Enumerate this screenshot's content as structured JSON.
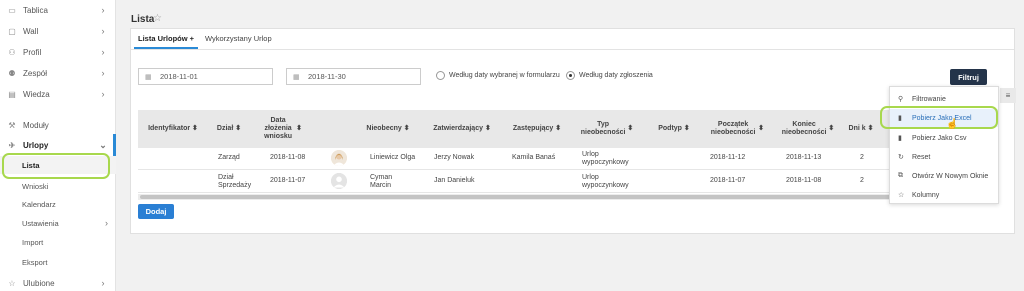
{
  "sidebar": {
    "items": [
      {
        "label": "Tablica",
        "icon": "monitor-icon"
      },
      {
        "label": "Wall",
        "icon": "wall-icon"
      },
      {
        "label": "Profil",
        "icon": "user-icon"
      },
      {
        "label": "Zespół",
        "icon": "users-icon"
      },
      {
        "label": "Wiedza",
        "icon": "book-icon"
      },
      {
        "label": "Moduły",
        "icon": "wrench-icon"
      },
      {
        "label": "Urlopy",
        "icon": "plane-icon"
      }
    ],
    "urlopy_sub": [
      "Lista",
      "Wnioski",
      "Kalendarz",
      "Ustawienia",
      "Import",
      "Eksport"
    ],
    "ulubione": "Ulubione"
  },
  "page": {
    "title": "Lista"
  },
  "tabs": [
    {
      "label": "Lista Urlopów +"
    },
    {
      "label": "Wykorzystany Urlop"
    }
  ],
  "filters": {
    "date_from": "2018-11-01",
    "date_to": "2018-11-30",
    "radio1": "Według daty wybranej w formularzu",
    "radio2": "Według daty zgłoszenia",
    "button": "Filtruj"
  },
  "table": {
    "headers": [
      "Identyfikator",
      "Dział",
      "Data złożenia wniosku",
      "Nieobecny",
      "Zatwierdzający",
      "Zastępujący",
      "Typ nieobecności",
      "Podtyp",
      "Początek nieobecności",
      "Koniec nieobecności",
      "Dni k"
    ],
    "rows": [
      {
        "dzial": "Zarząd",
        "data": "2018-11-08",
        "nieobecny": "Liniewicz Olga",
        "zatw": "Jerzy Nowak",
        "zast": "Kamila Banaś",
        "typ": "Urlop wypoczynkowy",
        "poczatek": "2018-11-12",
        "koniec": "2018-11-13",
        "dni": "2"
      },
      {
        "dzial": "Dział Sprzedaży",
        "data": "2018-11-07",
        "nieobecny": "Cyman Marcin",
        "zatw": "Jan Danieluk",
        "zast": "",
        "typ": "Urlop wypoczynkowy",
        "poczatek": "2018-11-07",
        "koniec": "2018-11-08",
        "dni": "2"
      }
    ]
  },
  "add_button": "Dodaj",
  "menu": {
    "items": [
      {
        "label": "Filtrowanie",
        "icon": "search-icon"
      },
      {
        "label": "Pobierz Jako Excel",
        "icon": "file-excel-icon"
      },
      {
        "label": "Pobierz Jako Csv",
        "icon": "file-icon"
      },
      {
        "label": "Reset",
        "icon": "refresh-icon"
      },
      {
        "label": "Otwórz W Nowym Oknie",
        "icon": "external-link-icon"
      },
      {
        "label": "Kolumny",
        "icon": "star-icon"
      }
    ]
  },
  "colors": {
    "accent": "#2a8ad6",
    "highlight": "#a8d84d",
    "filter_button": "#24344a"
  }
}
